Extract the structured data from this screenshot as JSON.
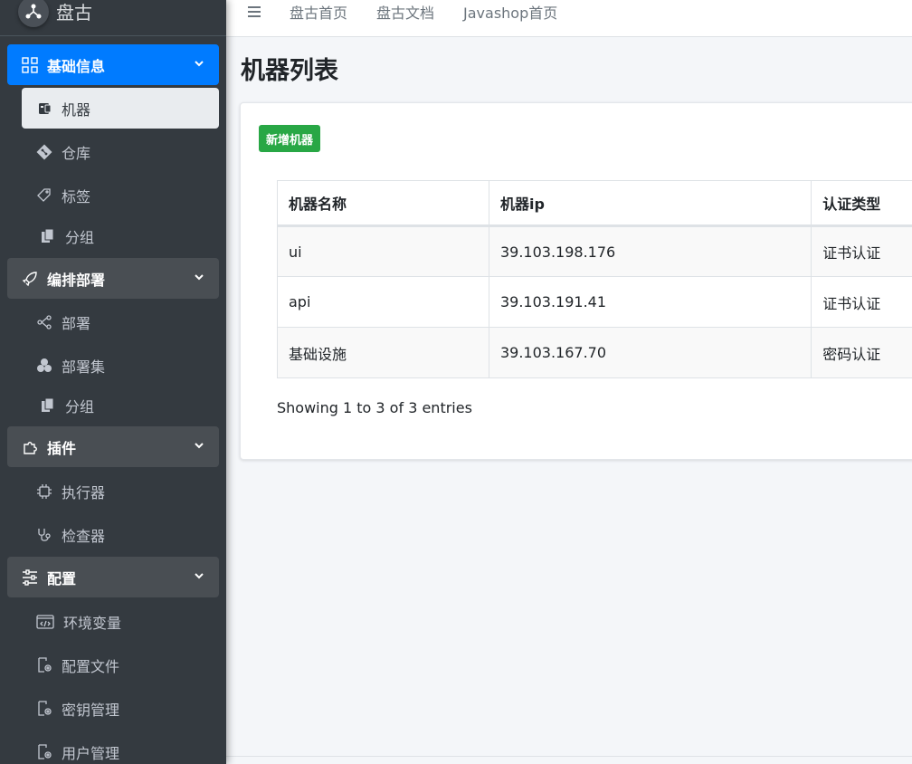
{
  "brand": {
    "name": "盘古"
  },
  "topbar": {
    "links": [
      "盘古首页",
      "盘古文档",
      "Javashop首页"
    ]
  },
  "sidebar": {
    "groups": [
      {
        "label": "基础信息",
        "children": [
          "机器",
          "仓库",
          "标签",
          "分组"
        ]
      },
      {
        "label": "编排部署",
        "children": [
          "部署",
          "部署集",
          "分组"
        ]
      },
      {
        "label": "插件",
        "children": [
          "执行器",
          "检查器"
        ]
      },
      {
        "label": "配置",
        "children": [
          "环境变量",
          "配置文件",
          "密钥管理",
          "用户管理"
        ]
      }
    ]
  },
  "page": {
    "title": "机器列表",
    "add_button": "新增机器",
    "info": "Showing 1 to 3 of 3 entries"
  },
  "table": {
    "headers": [
      "机器名称",
      "机器ip",
      "认证类型"
    ],
    "rows": [
      [
        "ui",
        "39.103.198.176",
        "证书认证"
      ],
      [
        "api",
        "39.103.191.41",
        "证书认证"
      ],
      [
        "基础设施",
        "39.103.167.70",
        "密码认证"
      ]
    ]
  },
  "colors": {
    "sidebar_bg": "#343a40",
    "active_blue": "#007bff",
    "add_green": "#28a745"
  }
}
